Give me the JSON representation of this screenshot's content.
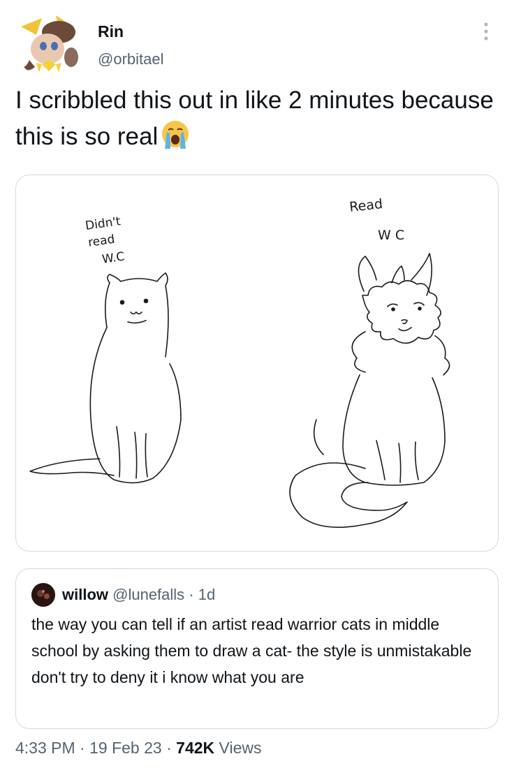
{
  "author": {
    "name": "Rin",
    "handle": "@orbitael"
  },
  "tweet": {
    "text": "I scribbled this out in like 2 minutes because this is so real",
    "emoji": "loudly-crying-face"
  },
  "media": {
    "left_label_line1": "Didn't",
    "left_label_line2": "read",
    "left_label_line3": "W.C",
    "right_label_line1": "Read",
    "right_label_line2": "W C"
  },
  "quote": {
    "name": "willow",
    "handle": "@lunefalls",
    "separator": "·",
    "age": "1d",
    "text": "the way you can tell if an artist read warrior cats in middle school by asking them to draw a cat- the style is unmistakable don't try to deny it i know what you are"
  },
  "footer": {
    "time": "4:33 PM",
    "date": "19 Feb 23",
    "separator": "·",
    "views_count": "742K",
    "views_label": "Views"
  },
  "colors": {
    "text": "#0f1419",
    "secondary": "#536471",
    "border": "#cfd9de",
    "sketch_line": "#1a1a1a"
  }
}
